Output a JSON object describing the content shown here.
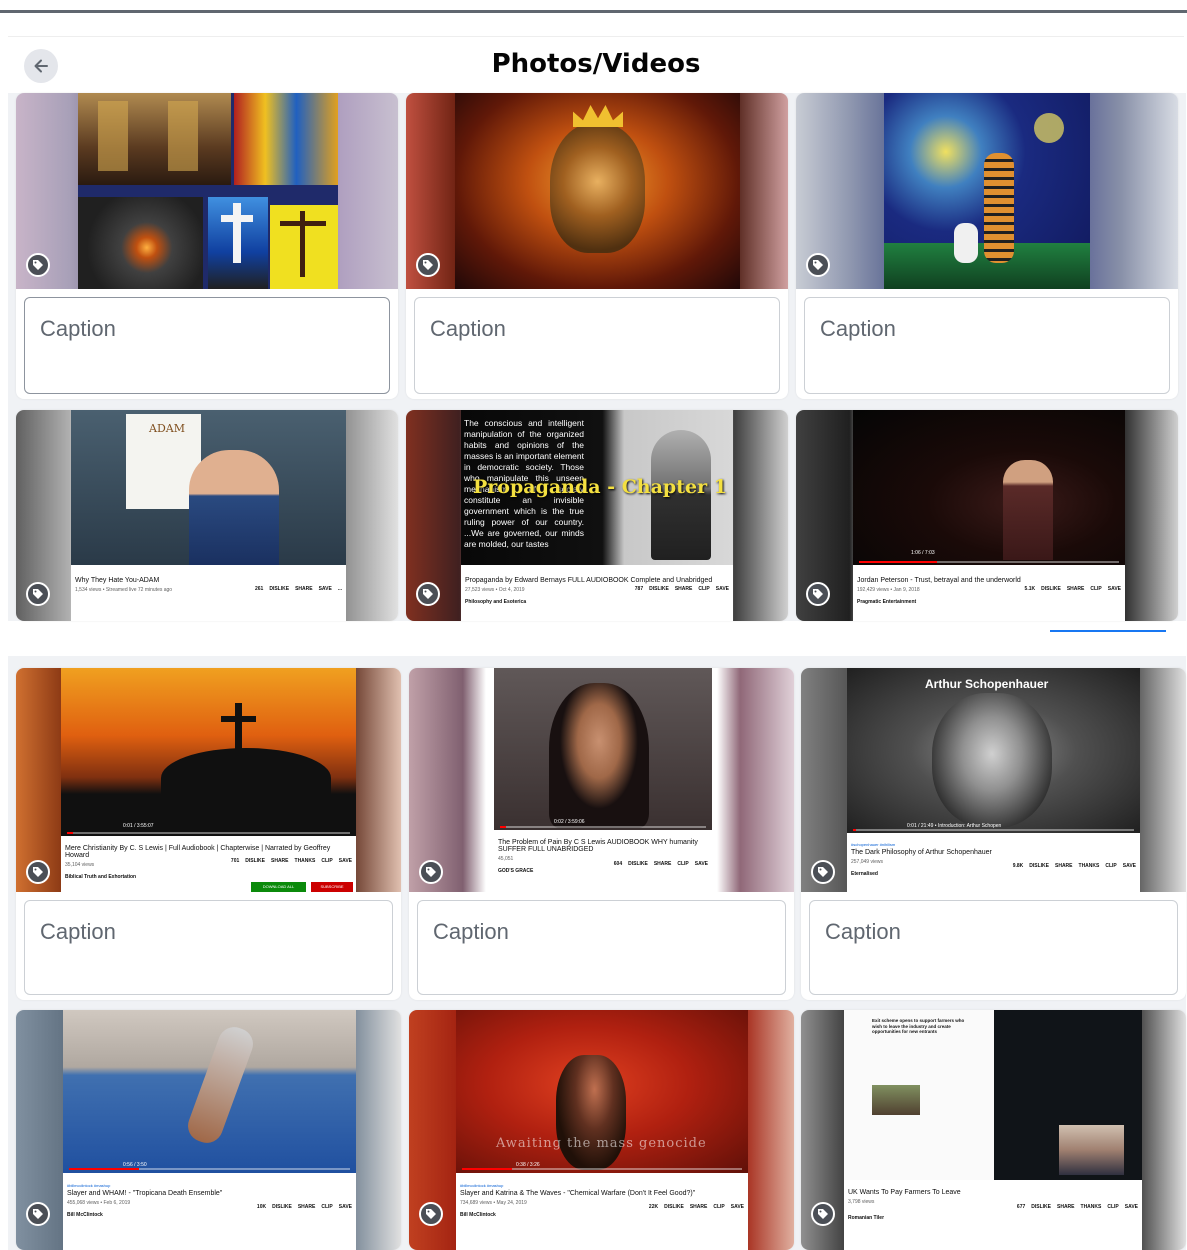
{
  "header": {
    "title": "Photos/Videos"
  },
  "caption_placeholder": "Caption",
  "colors": {
    "accent": "#1877f2",
    "panel": "#f0f2f5",
    "yt_red": "#ff0000"
  },
  "videos": [
    {
      "title": "Why They Hate You-ADAM",
      "meta": "1,534 views • Streamed live 72 minutes ago",
      "likes": "261",
      "channel": ""
    },
    {
      "title": "Propaganda by Edward Bernays FULL AUDIOBOOK Complete and Unabridged",
      "meta": "27,523 views • Oct 4, 2019",
      "likes": "787",
      "channel": "Philosophy and Esoterica",
      "overlay": "Propaganda - Chapter 1",
      "quote": "The conscious and intelligent manipulation of the organized habits and opinions of the masses is an important element in democratic society. Those who manipulate this unseen mechanism of society constitute an invisible government which is the true ruling power of our country. ...We are governed, our minds are molded, our tastes"
    },
    {
      "title": "Jordan Peterson - Trust, betrayal and the underworld",
      "meta": "192,429 views • Jan 9, 2018",
      "likes": "5.1K",
      "channel": "Pragmatic Entertainment",
      "time": "1:06 / 7:03"
    },
    {
      "title": "Mere Christianity By C. S Lewis | Full Audiobook | Chapterwise | Narrated by Geoffrey Howard",
      "meta": "35,104 views",
      "likes": "701",
      "channel": "Biblical Truth and Exhortation",
      "time": "0:01 / 3:55:07"
    },
    {
      "title": "The Problem of Pain By C S Lewis AUDIOBOOK WHY humanity SUFFER FULL UNABRIDGED",
      "meta": "45,051",
      "likes": "604",
      "channel": "GOD'S GRACE",
      "time": "0:02 / 3:59:06"
    },
    {
      "title": "The Dark Philosophy of Arthur Schopenhauer",
      "meta": "257,049 views",
      "likes": "9.8K",
      "channel": "Eternalised",
      "overlay": "Arthur Schopenhauer",
      "hashtag": "#schopenhauer #nihilism",
      "time": "0:01 / 21:49 • Introduction: Arthur Schopen"
    },
    {
      "title": "Slayer and WHAM! - \"Tropicana Death Ensemble\"",
      "meta": "455,068 views • Feb 6, 2019",
      "likes": "10K",
      "channel": "Bill McClintock",
      "hashtag": "#billmcclintock #mashup",
      "time": "0:56 / 3:50"
    },
    {
      "title": "Slayer and Katrina & The Waves - \"Chemical Warfare (Don't It Feel Good?)\"",
      "meta": "734,689 views • May 24, 2019",
      "likes": "22K",
      "channel": "Bill McClintock",
      "hashtag": "#billmcclintock #mashup",
      "overlay": "Awaiting the mass genocide",
      "time": "0:38 / 3:26"
    },
    {
      "title": "UK Wants To Pay Farmers To Leave",
      "meta": "3,798 views",
      "likes": "677",
      "channel": "Romanian Tiler",
      "headline": "Exit scheme opens to support farmers who wish to leave the industry and create opportunities for new entrants"
    }
  ],
  "actions": {
    "dislike": "DISLIKE",
    "share": "SHARE",
    "clip": "CLIP",
    "save": "SAVE",
    "thanks": "THANKS",
    "more": "..."
  },
  "buttons": {
    "download": "DOWNLOAD ALL",
    "subscribe": "SUBSCRIBE"
  }
}
